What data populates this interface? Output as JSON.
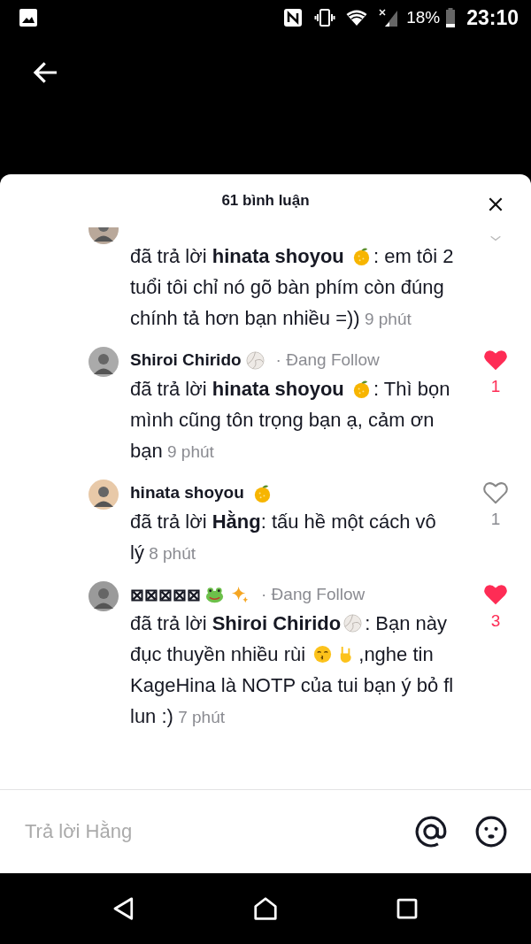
{
  "status_bar": {
    "battery": "18%",
    "time": "23:10"
  },
  "sheet": {
    "title": "61 bình luận"
  },
  "comments": [
    {
      "body": [
        {
          "kind": "text",
          "text": "đã trả lời "
        },
        {
          "kind": "mention",
          "text": "hinata shoyou "
        },
        {
          "kind": "orange"
        },
        {
          "kind": "text",
          "text": ": em tôi 2 tuổi tôi chỉ nó gõ bàn phím còn đúng chính tả hơn bạn nhiều =))"
        }
      ],
      "time": "9 phút"
    },
    {
      "author": {
        "name": "Shiroi Chirido",
        "badges": [
          {
            "kind": "volleyball"
          }
        ]
      },
      "follow": "· Đang Follow",
      "body": [
        {
          "kind": "text",
          "text": "đã trả lời "
        },
        {
          "kind": "mention",
          "text": "hinata shoyou "
        },
        {
          "kind": "orange"
        },
        {
          "kind": "text",
          "text": ": Thì bọn mình cũng tôn trọng bạn ạ, cảm ơn bạn"
        }
      ],
      "time": "9 phút",
      "likes": {
        "liked": true,
        "count": "1"
      }
    },
    {
      "author": {
        "name": "hinata shoyou ",
        "badges": [
          {
            "kind": "orange"
          }
        ]
      },
      "body": [
        {
          "kind": "text",
          "text": "đã trả lời "
        },
        {
          "kind": "mention",
          "text": "Hằng"
        },
        {
          "kind": "text",
          "text": ": tấu hề một cách vô lý"
        }
      ],
      "time": "8 phút",
      "likes": {
        "liked": false,
        "count": "1"
      }
    },
    {
      "author": {
        "name": "⊠⊠⊠⊠⊠",
        "badges": [
          {
            "kind": "frog"
          },
          {
            "kind": "sparkles"
          }
        ]
      },
      "follow": "· Đang Follow",
      "body": [
        {
          "kind": "text",
          "text": "đã trả lời "
        },
        {
          "kind": "mention",
          "text": "Shiroi Chirido"
        },
        {
          "kind": "volleyball"
        },
        {
          "kind": "text",
          "text": ": Bạn này đục thuyền nhiều rùi "
        },
        {
          "kind": "kiss"
        },
        {
          "kind": "horns"
        },
        {
          "kind": "text",
          "text": ",nghe tin KageHina là NOTP của tui bạn ý bỏ fl lun :)"
        }
      ],
      "time": "7 phút",
      "likes": {
        "liked": true,
        "count": "3"
      }
    }
  ],
  "reply_box": {
    "placeholder": "Trả lời Hằng"
  }
}
